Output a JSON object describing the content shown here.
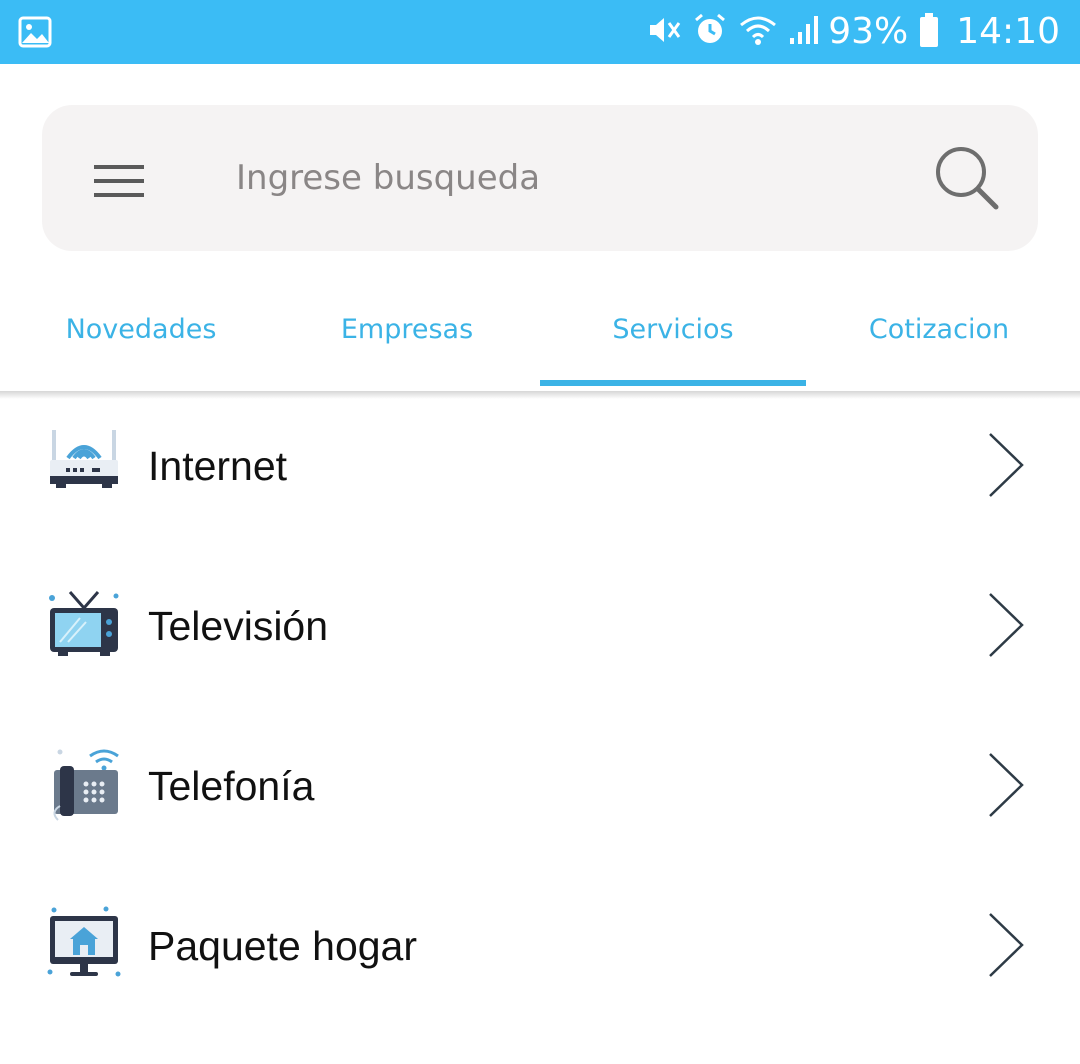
{
  "status_bar": {
    "battery": "93%",
    "time": "14:10"
  },
  "search": {
    "placeholder": "Ingrese busqueda"
  },
  "tabs": [
    {
      "label": "Novedades"
    },
    {
      "label": "Empresas"
    },
    {
      "label": "Servicios",
      "selected": true
    },
    {
      "label": "Cotizacion"
    }
  ],
  "services": [
    {
      "label": "Internet",
      "icon": "router-icon"
    },
    {
      "label": "Televisión",
      "icon": "tv-icon"
    },
    {
      "label": "Telefonía",
      "icon": "phone-icon"
    },
    {
      "label": "Paquete hogar",
      "icon": "home-monitor-icon"
    }
  ],
  "colors": {
    "status_bar": "#3bbcf5",
    "accent": "#3bb3e6",
    "search_bg": "#f5f3f3"
  }
}
